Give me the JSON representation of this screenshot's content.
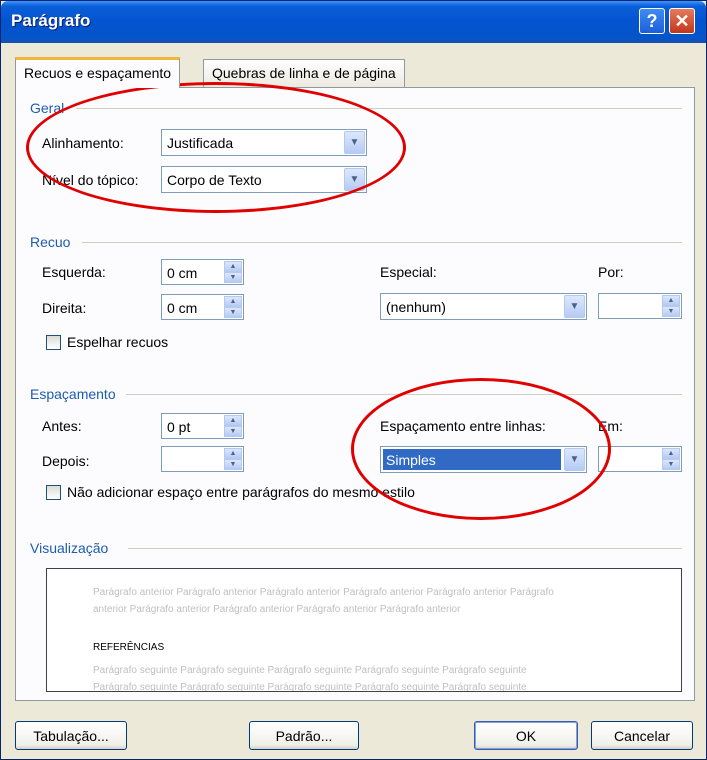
{
  "window": {
    "title": "Parágrafo",
    "help_glyph": "?",
    "close_glyph": "✕"
  },
  "tabs": [
    {
      "label": "Recuos e espaçamento",
      "active": true
    },
    {
      "label": "Quebras de linha e de página",
      "active": false
    }
  ],
  "geral": {
    "group": "Geral",
    "alignment_label": "Alinhamento:",
    "alignment_value": "Justificada",
    "outline_label": "Nível do tópico:",
    "outline_value": "Corpo de Texto"
  },
  "recuo": {
    "group": "Recuo",
    "left_label": "Esquerda:",
    "left_value": "0 cm",
    "right_label": "Direita:",
    "right_value": "0 cm",
    "special_label": "Especial:",
    "special_value": "(nenhum)",
    "by_label": "Por:",
    "by_value": "",
    "mirror_label": "Espelhar recuos"
  },
  "espacamento": {
    "group": "Espaçamento",
    "before_label": "Antes:",
    "before_value": "0 pt",
    "after_label": "Depois:",
    "after_value": "",
    "line_label": "Espaçamento entre linhas:",
    "line_value": "Simples",
    "at_label": "Em:",
    "at_value": "",
    "no_space_label": "Não adicionar espaço entre parágrafos do mesmo estilo"
  },
  "visualizacao": {
    "group": "Visualização",
    "prev_line1": "Parágrafo anterior Parágrafo anterior Parágrafo anterior Parágrafo anterior Parágrafo anterior Parágrafo",
    "prev_line2": "anterior Parágrafo anterior Parágrafo anterior Parágrafo anterior Parágrafo anterior",
    "main_text": "REFERÊNCIAS",
    "next_line1": "Parágrafo seguinte Parágrafo seguinte Parágrafo seguinte Parágrafo seguinte Parágrafo seguinte",
    "next_line2": "Parágrafo seguinte Parágrafo seguinte Parágrafo seguinte Parágrafo seguinte Parágrafo seguinte"
  },
  "buttons": {
    "tabs_label": "Tabulação...",
    "default_label": "Padrão...",
    "ok_label": "OK",
    "cancel_label": "Cancelar"
  },
  "colors": {
    "annotation": "#e00000",
    "group_label": "#1c5caf",
    "selection": "#316ac5"
  }
}
